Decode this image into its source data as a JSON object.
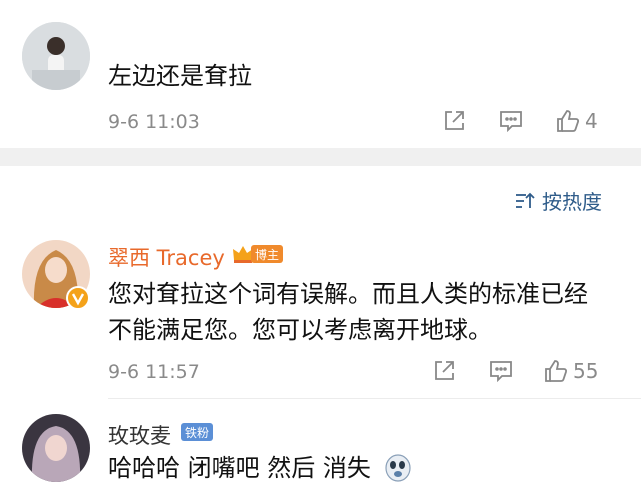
{
  "comments": [
    {
      "username": "",
      "text": "左边还是耷拉",
      "time": "9-6 11:03",
      "likes": "4"
    },
    {
      "username": "翠西 Tracey",
      "badge": "博主",
      "text_line1": "您对耷拉这个词有误解。而且人类的标准已经",
      "text_line2": "不能满足您。您可以考虑离开地球。",
      "time": "9-6 11:57",
      "likes": "55"
    },
    {
      "username": "玫玫麦",
      "badge": "铁粉",
      "text": "哈哈哈 闭嘴吧 然后 消失"
    }
  ],
  "sort": {
    "label": "按热度"
  },
  "colors": {
    "author_name": "#e8692b",
    "badge_blogger": "#f08a2c",
    "badge_fan": "#5b8fd6",
    "link_blue": "#2f5c8a"
  }
}
